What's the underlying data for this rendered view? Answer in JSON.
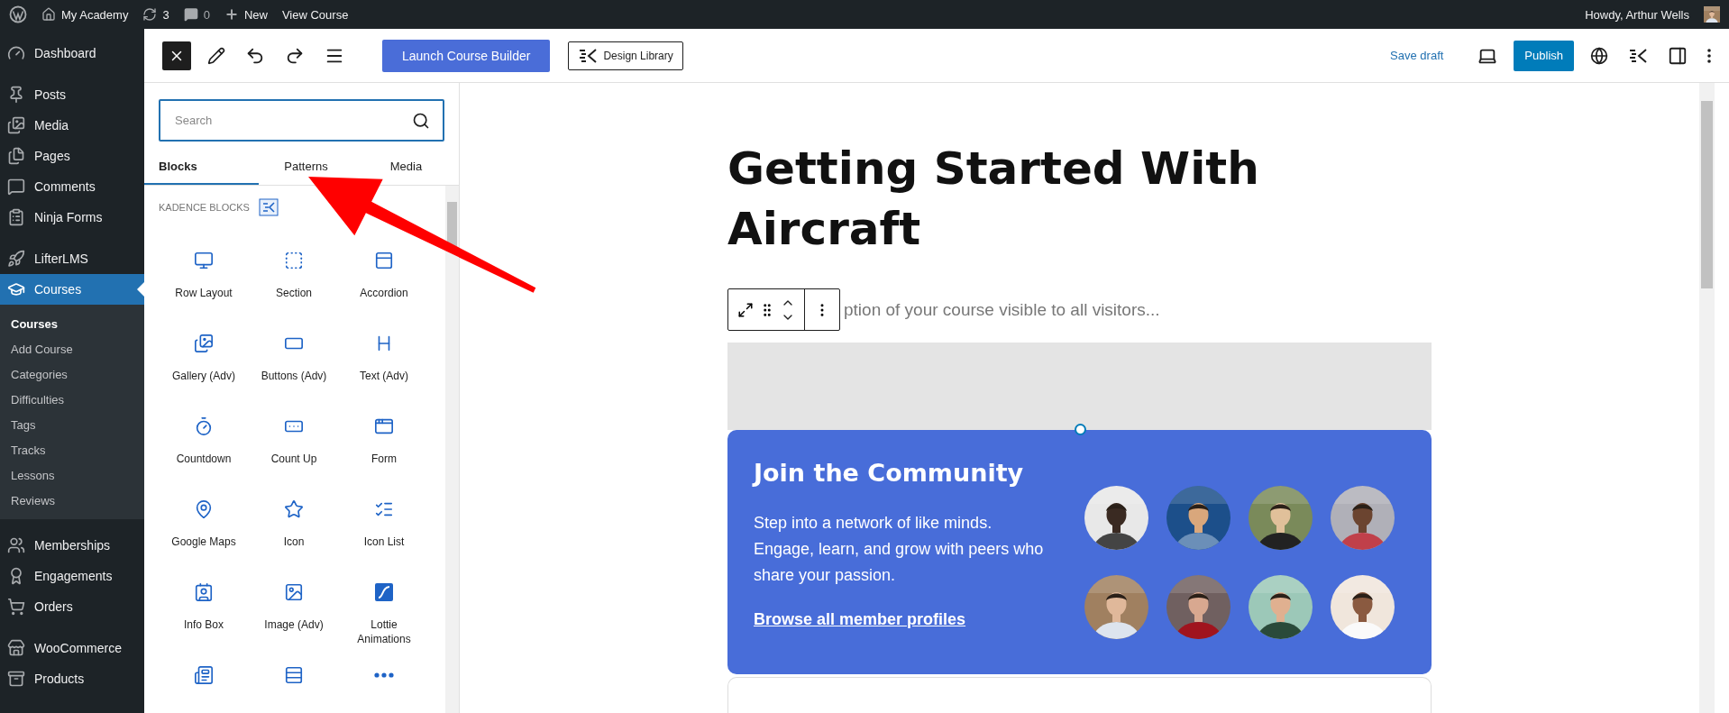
{
  "admin_bar": {
    "site": "My Academy",
    "updates": "3",
    "comments": "0",
    "new": "New",
    "view": "View Course",
    "greeting": "Howdy, Arthur Wells"
  },
  "sidebar": {
    "groups": [
      [
        {
          "label": "Dashboard",
          "selected": false
        }
      ],
      [
        {
          "label": "Posts",
          "selected": false
        },
        {
          "label": "Media",
          "selected": false
        },
        {
          "label": "Pages",
          "selected": false
        },
        {
          "label": "Comments",
          "selected": false
        },
        {
          "label": "Ninja Forms",
          "selected": false
        }
      ],
      [
        {
          "label": "LifterLMS",
          "selected": false
        },
        {
          "label": "Courses",
          "selected": true,
          "children": [
            {
              "label": "Courses",
              "selected": true
            },
            {
              "label": "Add Course",
              "selected": false
            },
            {
              "label": "Categories",
              "selected": false
            },
            {
              "label": "Difficulties",
              "selected": false
            },
            {
              "label": "Tags",
              "selected": false
            },
            {
              "label": "Tracks",
              "selected": false
            },
            {
              "label": "Lessons",
              "selected": false
            },
            {
              "label": "Reviews",
              "selected": false
            }
          ]
        }
      ],
      [
        {
          "label": "Memberships",
          "selected": false
        },
        {
          "label": "Engagements",
          "selected": false
        },
        {
          "label": "Orders",
          "selected": false
        }
      ],
      [
        {
          "label": "WooCommerce",
          "selected": false
        },
        {
          "label": "Products",
          "selected": false
        }
      ]
    ]
  },
  "header": {
    "launch": "Launch Course Builder",
    "library": "Design Library",
    "save": "Save draft",
    "publish": "Publish"
  },
  "inserter": {
    "search": {
      "placeholder": "Search"
    },
    "tabs": [
      {
        "label": "Blocks",
        "selected": true
      },
      {
        "label": "Patterns",
        "selected": false
      },
      {
        "label": "Media",
        "selected": false
      }
    ],
    "section": "KADENCE BLOCKS",
    "blocks": [
      {
        "label": "Row Layout"
      },
      {
        "label": "Section"
      },
      {
        "label": "Accordion"
      },
      {
        "label": "Gallery (Adv)"
      },
      {
        "label": "Buttons (Adv)"
      },
      {
        "label": "Text (Adv)"
      },
      {
        "label": "Countdown"
      },
      {
        "label": "Count Up"
      },
      {
        "label": "Form"
      },
      {
        "label": "Google Maps"
      },
      {
        "label": "Icon"
      },
      {
        "label": "Icon List"
      },
      {
        "label": "Info Box"
      },
      {
        "label": "Image (Adv)"
      },
      {
        "label": "Lottie Animations"
      }
    ]
  },
  "post": {
    "title": "Getting Started With Aircraft",
    "excerpt": "ption of your course visible to all visitors...",
    "card": {
      "heading": "Join the Community",
      "text": "Step into a network of like minds. Engage, learn, and grow with peers who share your passion.",
      "link": "Browse all member profiles"
    }
  }
}
